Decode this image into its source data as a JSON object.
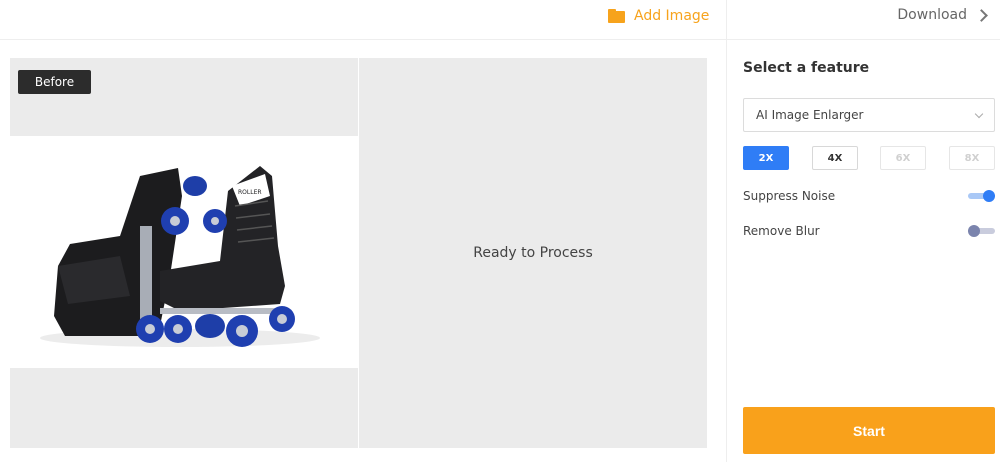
{
  "toolbar": {
    "add_image_label": "Add Image",
    "download_label": "Download",
    "accent_color": "#f7a31c"
  },
  "preview": {
    "before_label": "Before",
    "after_status": "Ready to Process"
  },
  "panel": {
    "title": "Select a feature",
    "feature_selected": "AI Image Enlarger",
    "scales": [
      {
        "label": "2X",
        "state": "active"
      },
      {
        "label": "4X",
        "state": "enabled"
      },
      {
        "label": "6X",
        "state": "disabled"
      },
      {
        "label": "8X",
        "state": "disabled"
      }
    ],
    "toggles": [
      {
        "label": "Suppress Noise",
        "on": true
      },
      {
        "label": "Remove Blur",
        "on": false
      }
    ],
    "start_label": "Start",
    "start_color": "#f9a11b",
    "active_color": "#2f7df6"
  }
}
